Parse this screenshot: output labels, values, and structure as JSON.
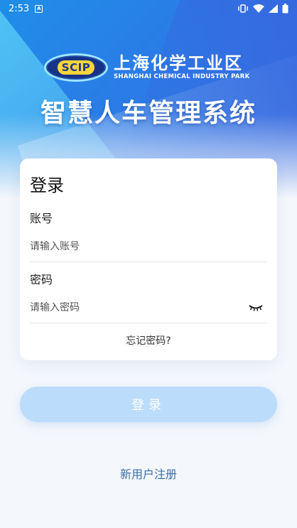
{
  "status": {
    "time": "2:53"
  },
  "brand": {
    "badge": "SCIP",
    "name_cn": "上海化学工业区",
    "name_en": "SHANGHAI CHEMICAL INDUSTRY PARK",
    "system_title": "智慧人车管理系统"
  },
  "login_card": {
    "title": "登录",
    "account_label": "账号",
    "account_placeholder": "请输入账号",
    "password_label": "密码",
    "password_placeholder": "请输入密码",
    "forgot_label": "忘记密码?"
  },
  "actions": {
    "login_label": "登录",
    "register_label": "新用户注册"
  },
  "colors": {
    "primary": "#2a7de6",
    "button_disabled": "#bcdcfb",
    "link": "#3a6ea8"
  }
}
